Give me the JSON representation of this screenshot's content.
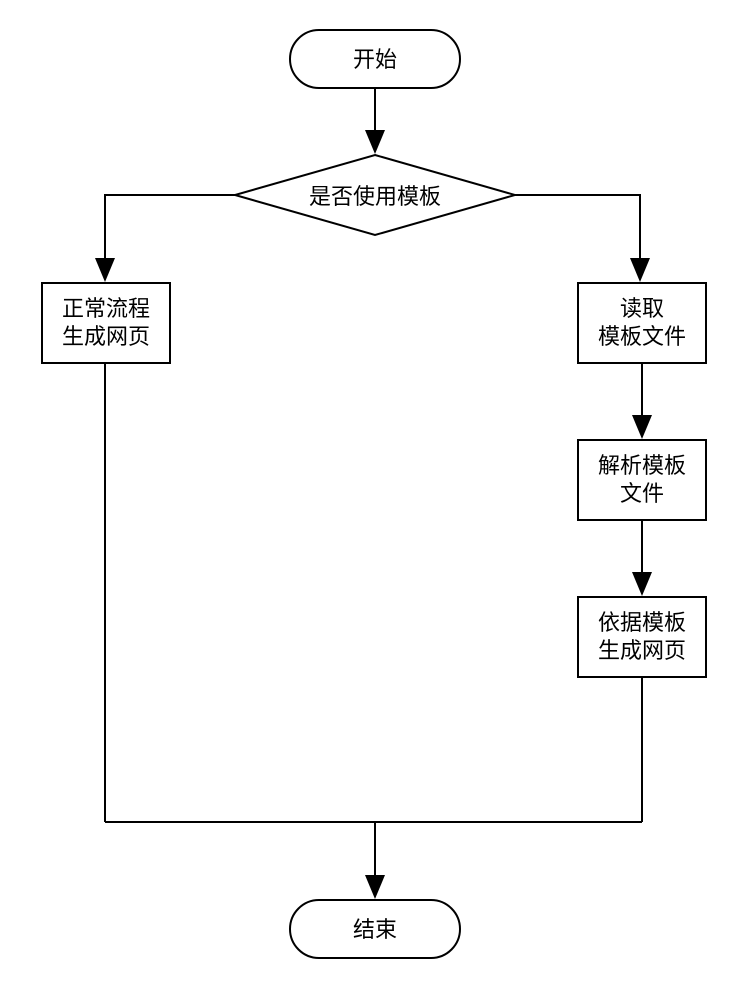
{
  "flowchart": {
    "start": "开始",
    "decision": "是否使用模板",
    "leftProcess": {
      "line1": "正常流程",
      "line2": "生成网页"
    },
    "rightStep1": {
      "line1": "读取",
      "line2": "模板文件"
    },
    "rightStep2": {
      "line1": "解析模板",
      "line2": "文件"
    },
    "rightStep3": {
      "line1": "依据模板",
      "line2": "生成网页"
    },
    "end": "结束"
  }
}
